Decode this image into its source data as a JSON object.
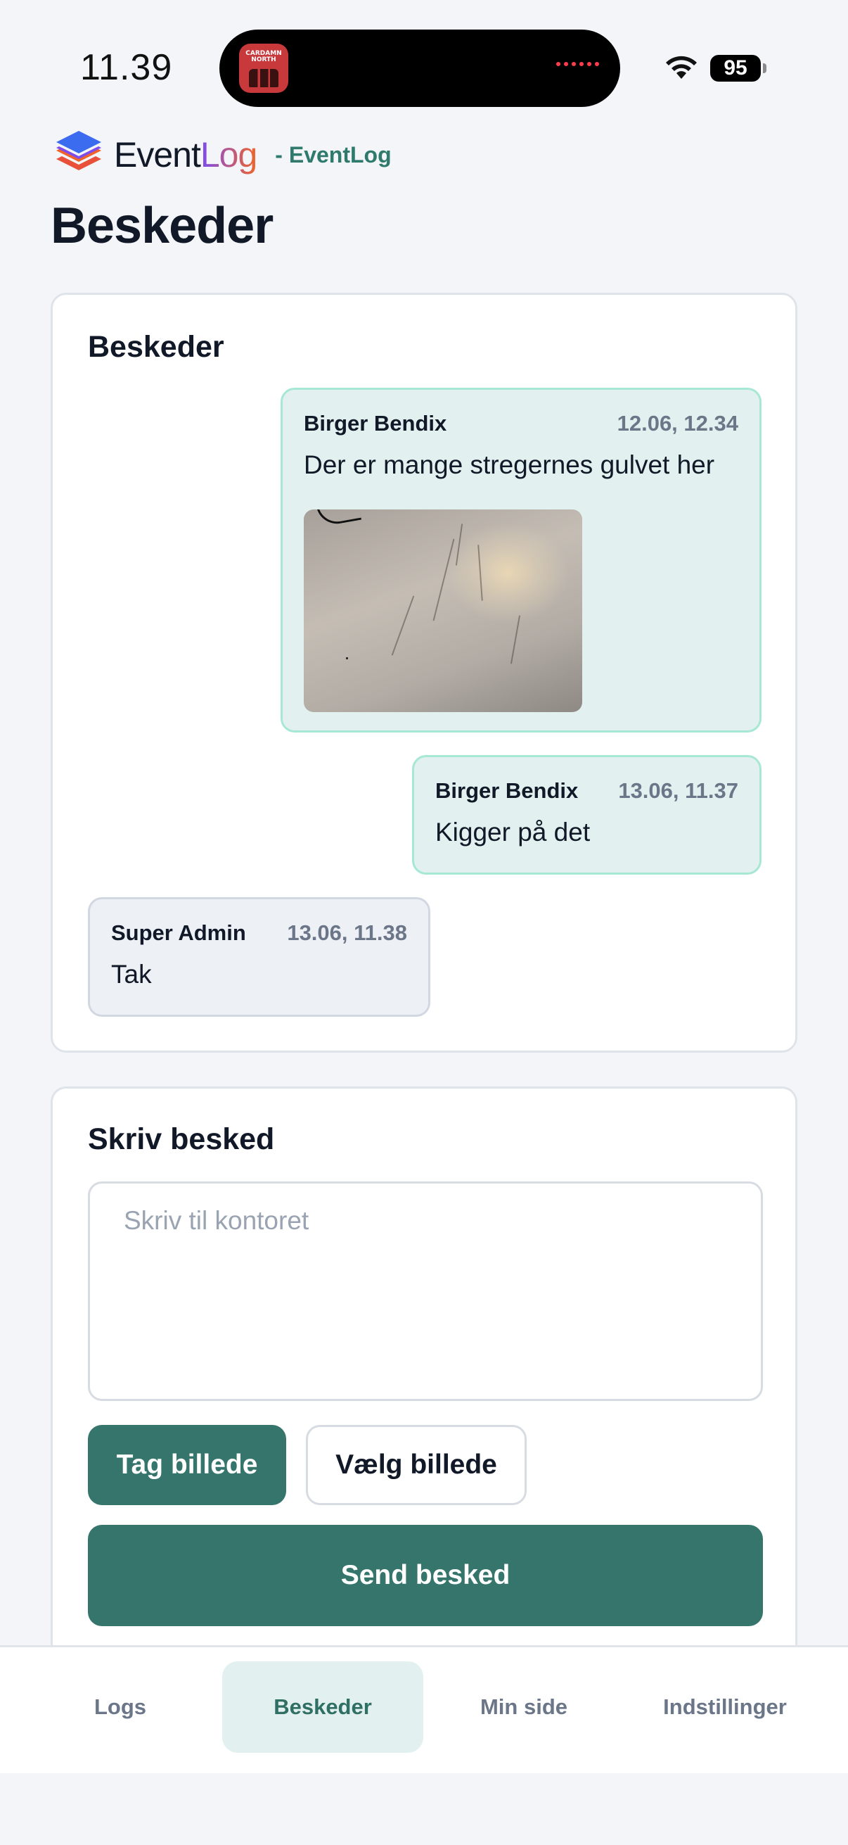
{
  "status_bar": {
    "time": "11.39",
    "battery": "95",
    "island_app_label": "CARDAMN NORTH"
  },
  "header": {
    "brand_part1": "Event",
    "brand_part2": "Log",
    "brand_suffix": "- EventLog",
    "page_title": "Beskeder"
  },
  "messages_card": {
    "title": "Beskeder",
    "messages": [
      {
        "author": "Birger Bendix",
        "time": "12.06, 12.34",
        "text": "Der er mange stregernes gulvet her",
        "has_image": true,
        "mine": true
      },
      {
        "author": "Birger Bendix",
        "time": "13.06, 11.37",
        "text": "Kigger på det",
        "has_image": false,
        "mine": true
      },
      {
        "author": "Super Admin",
        "time": "13.06, 11.38",
        "text": "Tak",
        "has_image": false,
        "mine": false
      }
    ]
  },
  "compose_card": {
    "title": "Skriv besked",
    "input_placeholder": "Skriv til kontoret",
    "input_value": "",
    "take_photo_label": "Tag billede",
    "choose_photo_label": "Vælg billede",
    "send_label": "Send besked"
  },
  "bottom_nav": {
    "items": [
      {
        "label": "Logs",
        "active": false
      },
      {
        "label": "Beskeder",
        "active": true
      },
      {
        "label": "Min side",
        "active": false
      },
      {
        "label": "Indstillinger",
        "active": false
      }
    ]
  },
  "colors": {
    "accent": "#35756b",
    "own_message_bg": "#e2f1ef",
    "own_message_border": "#a6e8d4",
    "other_message_bg": "#edf0f5",
    "page_bg": "#f3f5f9"
  }
}
